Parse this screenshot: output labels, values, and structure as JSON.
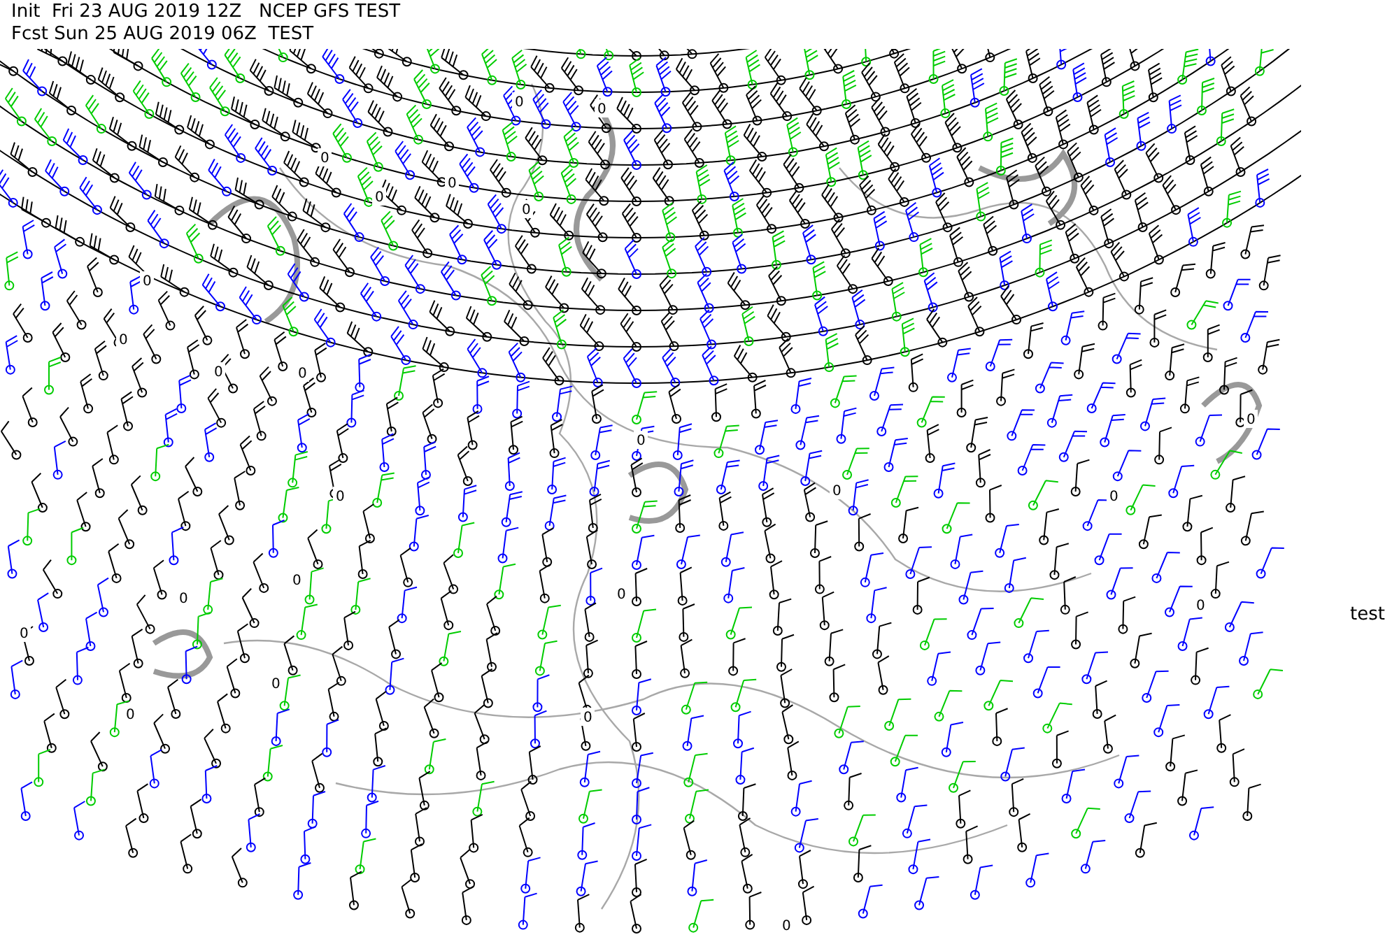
{
  "header": {
    "init_line": "Init  Fri 23 AUG 2019 12Z   NCEP GFS TEST",
    "forecast_line": "Fcst Sun 25 AUG 2019 06Z  TEST"
  },
  "side_label": "test",
  "contour_labels": [
    "0",
    "0",
    "0",
    "0",
    "0",
    "0",
    "0",
    "0",
    "0",
    "0",
    "0",
    "0",
    "0",
    "0",
    "0",
    "0",
    "0",
    "0",
    "0",
    "0",
    "0",
    "0",
    "0",
    "0"
  ]
}
